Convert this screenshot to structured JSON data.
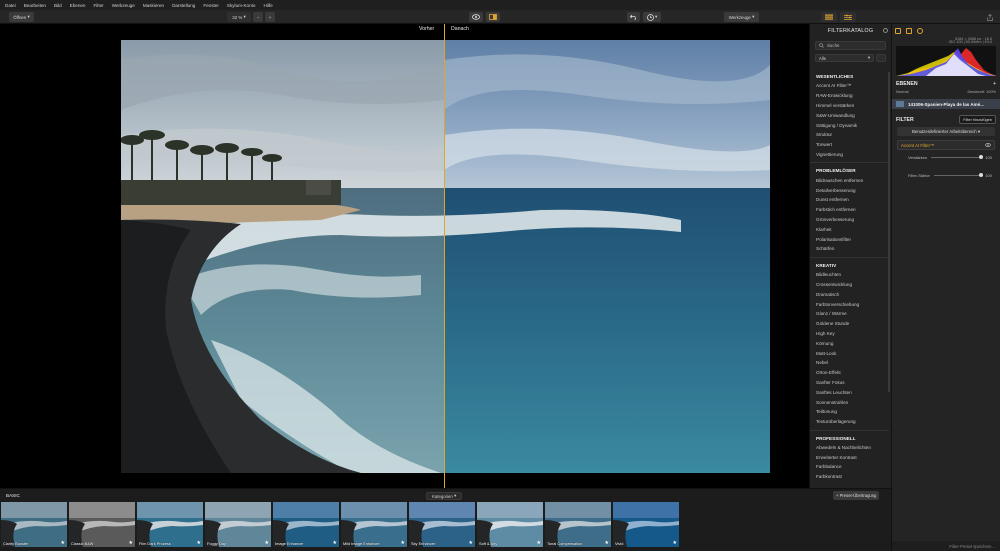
{
  "menu": [
    "Datei",
    "Bearbeiten",
    "Bild",
    "Ebenen",
    "Filter",
    "Werkzeuge",
    "Maskieren",
    "Darstellung",
    "Fenster",
    "Skylum-Konto",
    "Hilfe"
  ],
  "toolbar": {
    "open_label": "Öffnen",
    "zoom_value": "32 %",
    "zoom_minus": "−",
    "zoom_plus": "+",
    "tools_label": "Werkzeuge"
  },
  "compare": {
    "before_label": "Vorher",
    "after_label": "Danach"
  },
  "filter_catalog": {
    "title": "FILTERKATALOG",
    "search_placeholder": "Suche",
    "category_select": "Alle",
    "sections": [
      {
        "name": "WESENTLICHES",
        "items": [
          "Accent AI Filter™",
          "RAW-Entwicklung",
          "Himmel verstärken",
          "S&W-Umwandlung",
          "Sättigung / Dynamik",
          "Struktur",
          "Tonwert",
          "Vignettierung"
        ]
      },
      {
        "name": "PROBLEMLÖSER",
        "items": [
          "Bildrauschen entfernen",
          "Detailverbesserung",
          "Dunst entfernen",
          "Farbstich entfernen",
          "Grünverbesserung",
          "Klarheit",
          "Polarisationsfilter",
          "Schärfen"
        ]
      },
      {
        "name": "KREATIV",
        "items": [
          "Bildleuchten",
          "Crossentwicklung",
          "Dramatisch",
          "Farbtonverschiebung",
          "Glanz / Wärme",
          "Goldene Stunde",
          "High Key",
          "Körnung",
          "Matt-Look",
          "Nebel",
          "Orton-Effekt",
          "Sanfter Fokus",
          "Sanftes Leuchten",
          "Sonnenstrahlen",
          "Teiltonung",
          "Texturüberlagerung"
        ]
      },
      {
        "name": "PROFESSIONELL",
        "items": [
          "Abwedeln & Nachbelichten",
          "Erweiterter Kontrast",
          "Farbbalance",
          "Farbkontrast"
        ]
      }
    ]
  },
  "right_panel": {
    "histo_info_1": "5184 × 3456 px · 16.5",
    "histo_info_2": "ISO 100 | 50,00mm | f/4,0",
    "layers_title": "EBENEN",
    "blend_mode": "Normal",
    "opacity": "Deckkraft: 100%",
    "layer_name": "141006-Spanien-Playa de las Amé...",
    "filter_title": "FILTER",
    "add_filter": "Filter hinzufügen",
    "workspace": "Benutzerdefinierter Arbeitsbereich",
    "filter_name": "Accent AI Filter™",
    "slider1_label": "Verstärken",
    "slider1_value": "100",
    "slider2_label": "Filter-Stärke",
    "slider2_value": "100",
    "save_preset": "Filter-Preset speichern..."
  },
  "filmstrip": {
    "group": "BASIC",
    "categories_label": "Kategorien",
    "new_preset": "+ Preset-Übertragung",
    "presets": [
      "Clarity Booster",
      "Classic B&W",
      "Film Dark Process",
      "Foggy Day",
      "Image Enhancer",
      "Mild Image Enhancer",
      "Sky Enhancer",
      "Soft & Airy",
      "Tonal Compensation",
      "Vivid"
    ]
  }
}
